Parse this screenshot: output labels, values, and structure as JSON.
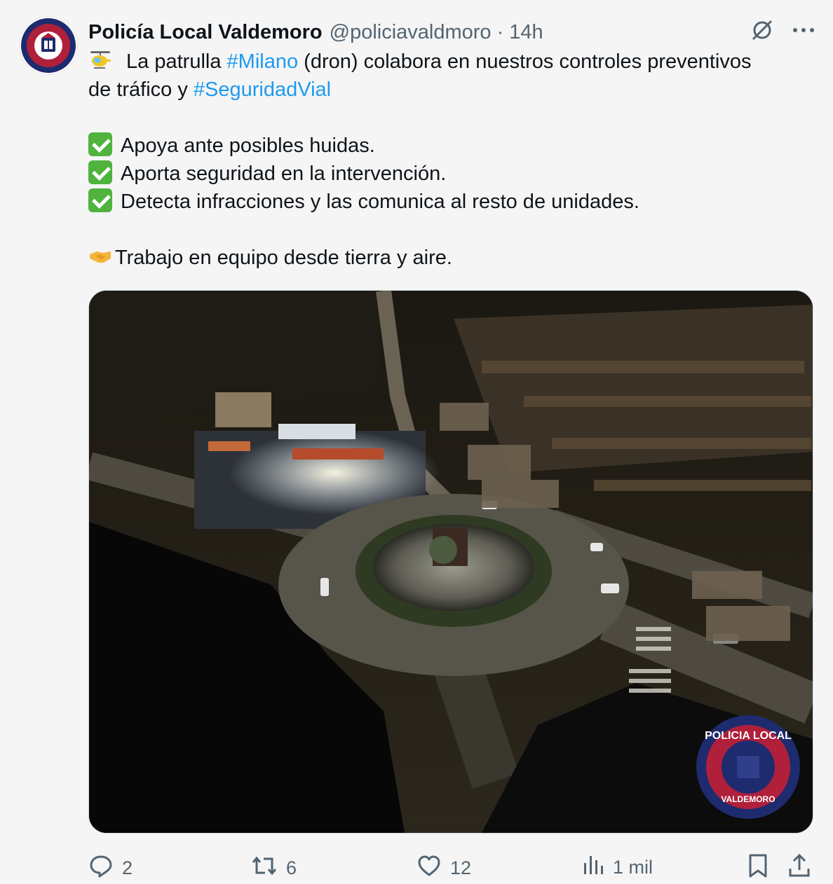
{
  "tweet": {
    "display_name": "Policía Local Valdemoro",
    "handle": "@policiavaldmoro",
    "separator": "·",
    "time": "14h",
    "line1_pre": " La patrulla ",
    "hashtag1": "#Milano",
    "line1_post": " (dron) colabora en nuestros controles preventivos",
    "line2_pre": "de tráfico y ",
    "hashtag2": "#SeguridadVial",
    "bullets": [
      "Apoya ante posibles huidas.",
      "Aporta seguridad en la intervención.",
      "Detecta infracciones y las comunica al resto de unidades."
    ],
    "closing": "Trabajo en equipo desde tierra y aire."
  },
  "logo": {
    "top_text": "POLICIA LOCAL",
    "bottom_text": "VALDEMORO"
  },
  "actions": {
    "replies": "2",
    "reposts": "6",
    "likes": "12",
    "views": "1 mil"
  },
  "icons": {
    "helicopter": "helicopter-icon",
    "check": "check-mark-icon",
    "handshake": "handshake-icon",
    "grok": "grok-icon",
    "more": "more-icon",
    "reply": "reply-icon",
    "repost": "repost-icon",
    "like": "heart-icon",
    "views": "views-icon",
    "bookmark": "bookmark-icon",
    "share": "share-icon"
  },
  "colors": {
    "hashtag": "#1d9bf0",
    "secondary_text": "#536471",
    "logo_red": "#b0203a",
    "logo_navy": "#1e2b6e"
  }
}
